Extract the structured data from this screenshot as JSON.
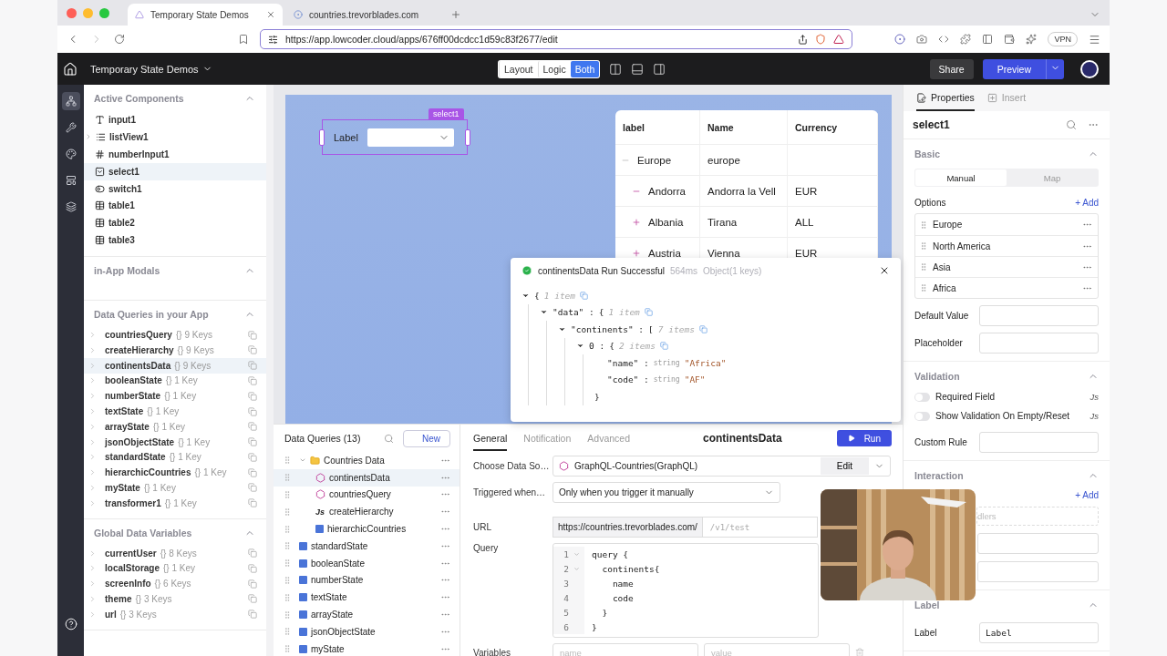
{
  "browser": {
    "tabs": [
      {
        "title": "Temporary State Demos",
        "selected": true
      },
      {
        "title": "countries.trevorblades.com",
        "selected": false
      }
    ],
    "url": "https://app.lowcoder.cloud/apps/676ff00dcdcc1d59c83f2677/edit",
    "vpn": "VPN"
  },
  "header": {
    "title": "Temporary State Demos",
    "modes": [
      {
        "label": "Layout",
        "selected": false
      },
      {
        "label": "Logic",
        "selected": false
      },
      {
        "label": "Both",
        "selected": true
      }
    ],
    "share": "Share",
    "preview": "Preview"
  },
  "rail": [
    {
      "selected": true
    },
    {
      "selected": false
    },
    {
      "selected": false
    },
    {
      "selected": false
    },
    {
      "selected": false
    }
  ],
  "left_panel": {
    "active_components": {
      "title": "Active Components",
      "expanded": true,
      "items": [
        {
          "name": "input1",
          "kind": "input",
          "selected": false,
          "expandable": false
        },
        {
          "name": "listView1",
          "kind": "list",
          "selected": false,
          "expandable": true
        },
        {
          "name": "numberInput1",
          "kind": "number",
          "selected": false,
          "expandable": false
        },
        {
          "name": "select1",
          "kind": "select",
          "selected": true,
          "expandable": false
        },
        {
          "name": "switch1",
          "kind": "switch",
          "selected": false,
          "expandable": false
        },
        {
          "name": "table1",
          "kind": "table",
          "selected": false,
          "expandable": false
        },
        {
          "name": "table2",
          "kind": "table",
          "selected": false,
          "expandable": false
        },
        {
          "name": "table3",
          "kind": "table",
          "selected": false,
          "expandable": false
        }
      ]
    },
    "modals": {
      "title": "in-App Modals",
      "expanded": true
    },
    "data_queries": {
      "title": "Data Queries in your App",
      "expanded": true,
      "items": [
        {
          "name": "countriesQuery",
          "keys": "{} 9 Keys",
          "selected": false
        },
        {
          "name": "createHierarchy",
          "keys": "{} 9 Keys",
          "selected": false
        },
        {
          "name": "continentsData",
          "keys": "{} 9 Keys",
          "selected": true
        },
        {
          "name": "booleanState",
          "keys": "{} 1 Key",
          "selected": false
        },
        {
          "name": "numberState",
          "keys": "{} 1 Key",
          "selected": false
        },
        {
          "name": "textState",
          "keys": "{} 1 Key",
          "selected": false
        },
        {
          "name": "arrayState",
          "keys": "{} 1 Key",
          "selected": false
        },
        {
          "name": "jsonObjectState",
          "keys": "{} 1 Key",
          "selected": false
        },
        {
          "name": "standardState",
          "keys": "{} 1 Key",
          "selected": false
        },
        {
          "name": "hierarchicCountries",
          "keys": "{} 1 Key",
          "selected": false
        },
        {
          "name": "myState",
          "keys": "{} 1 Key",
          "selected": false
        },
        {
          "name": "transformer1",
          "keys": "{} 1 Key",
          "selected": false
        }
      ]
    },
    "globals": {
      "title": "Global Data Variables",
      "expanded": true,
      "items": [
        {
          "name": "currentUser",
          "keys": "{} 8 Keys",
          "selected": false
        },
        {
          "name": "localStorage",
          "keys": "{} 1 Key",
          "selected": false
        },
        {
          "name": "screenInfo",
          "keys": "{} 6 Keys",
          "selected": false
        },
        {
          "name": "theme",
          "keys": "{} 3 Keys",
          "selected": false
        },
        {
          "name": "url",
          "keys": "{} 3 Keys",
          "selected": false
        }
      ]
    }
  },
  "canvas": {
    "select": {
      "tag": "select1",
      "label": "Label"
    },
    "table": {
      "columns": [
        "label",
        "Name",
        "Currency"
      ],
      "rows": [
        {
          "cells": [
            "Europe",
            "europe"
          ],
          "expanded": true,
          "children": [
            {
              "cells": [
                "Andorra",
                "Andorra la Vell",
                "EUR"
              ],
              "expanded": true
            },
            {
              "cells": [
                "Albania",
                "Tirana",
                "ALL"
              ],
              "expanded": false
            },
            {
              "cells": [
                "Austria",
                "Vienna",
                "EUR"
              ],
              "expanded": false
            }
          ]
        }
      ]
    }
  },
  "popup": {
    "title": "continentsData Run Successful",
    "duration": "564ms",
    "summary": "Object(1 keys)",
    "result": {
      "open": "{",
      "count": "1 item",
      "expanded": true,
      "children": [
        {
          "key": "\"data\" :",
          "open": "{",
          "count": "1 item",
          "expanded": true,
          "children": [
            {
              "key": "\"continents\" :",
              "open": "[",
              "count": "7 items",
              "expanded": true,
              "children": [
                {
                  "key": "0 :",
                  "open": "{",
                  "count": "2 items",
                  "expanded": true,
                  "close": "}",
                  "children": [
                    {
                      "key": "\"name\" :",
                      "type": "string",
                      "value": "\"Africa\""
                    },
                    {
                      "key": "\"code\" :",
                      "type": "string",
                      "value": "\"AF\""
                    }
                  ]
                }
              ]
            }
          ]
        }
      ]
    }
  },
  "queries": {
    "title": "Data Queries (13)",
    "new": "New",
    "items": [
      {
        "name": "Countries Data",
        "kind": "folder",
        "selected": false,
        "expanded": true,
        "children": [
          {
            "name": "continentsData",
            "kind": "graphql",
            "selected": true
          },
          {
            "name": "countriesQuery",
            "kind": "graphql",
            "selected": false
          },
          {
            "name": "createHierarchy",
            "kind": "js",
            "badge": "Js",
            "selected": false
          },
          {
            "name": "hierarchicCountries",
            "kind": "state",
            "selected": false
          }
        ]
      },
      {
        "name": "standardState",
        "kind": "state",
        "selected": false
      },
      {
        "name": "booleanState",
        "kind": "state",
        "selected": false
      },
      {
        "name": "numberState",
        "kind": "state",
        "selected": false
      },
      {
        "name": "textState",
        "kind": "state",
        "selected": false
      },
      {
        "name": "arrayState",
        "kind": "state",
        "selected": false
      },
      {
        "name": "jsonObjectState",
        "kind": "state",
        "selected": false
      },
      {
        "name": "myState",
        "kind": "state",
        "selected": false
      }
    ]
  },
  "editor": {
    "tabs": [
      {
        "label": "General",
        "selected": true
      },
      {
        "label": "Notification",
        "selected": false
      },
      {
        "label": "Advanced",
        "selected": false
      }
    ],
    "title": "continentsData",
    "run": "Run",
    "fields": [
      {
        "kind": "source",
        "label": "Choose Data So…",
        "value": "GraphQL-Countries(GraphQL)",
        "action": "Edit"
      },
      {
        "kind": "select",
        "label": "Triggered when…",
        "value": "Only when you trigger it manually"
      },
      {
        "kind": "url",
        "label": "URL",
        "base": "https://countries.trevorblades.com/",
        "placeholder": "/v1/test"
      },
      {
        "kind": "code",
        "label": "Query",
        "lines": [
          {
            "num": "1",
            "text": "query {",
            "foldable": true
          },
          {
            "num": "2",
            "text": "  continents{",
            "foldable": true
          },
          {
            "num": "3",
            "text": "    name",
            "foldable": false
          },
          {
            "num": "4",
            "text": "    code",
            "foldable": false
          },
          {
            "num": "5",
            "text": "  }",
            "foldable": false
          },
          {
            "num": "6",
            "text": "}",
            "foldable": false
          }
        ]
      },
      {
        "kind": "variables",
        "label": "Variables",
        "name_placeholder": "name",
        "value_placeholder": "value"
      }
    ]
  },
  "right_panel": {
    "tabs": [
      {
        "label": "Properties",
        "selected": true
      },
      {
        "label": "Insert",
        "selected": false
      }
    ],
    "component": "select1",
    "sections": [
      {
        "kind": "basic",
        "title": "Basic",
        "expanded": true,
        "modes": [
          {
            "label": "Manual",
            "selected": true
          },
          {
            "label": "Map",
            "selected": false
          }
        ],
        "options_label": "Options",
        "add": "+ Add",
        "options": [
          "Europe",
          "North America",
          "Asia",
          "Africa"
        ],
        "fields": [
          {
            "label": "Default Value"
          },
          {
            "label": "Placeholder"
          }
        ]
      },
      {
        "kind": "validation",
        "title": "Validation",
        "expanded": true,
        "switches": [
          {
            "label": "Required Field",
            "on": false,
            "badge": "Js"
          },
          {
            "label": "Show Validation On Empty/Reset",
            "on": false,
            "badge": "Js"
          }
        ],
        "fields": [
          {
            "label": "Custom Rule"
          }
        ]
      },
      {
        "kind": "interaction",
        "title": "Interaction",
        "expanded": true,
        "add": "+ Add",
        "hint": "dlers"
      },
      {
        "kind": "label",
        "title": "Label",
        "expanded": true,
        "fields": [
          {
            "label": "Label",
            "value": "Label"
          }
        ]
      }
    ]
  }
}
